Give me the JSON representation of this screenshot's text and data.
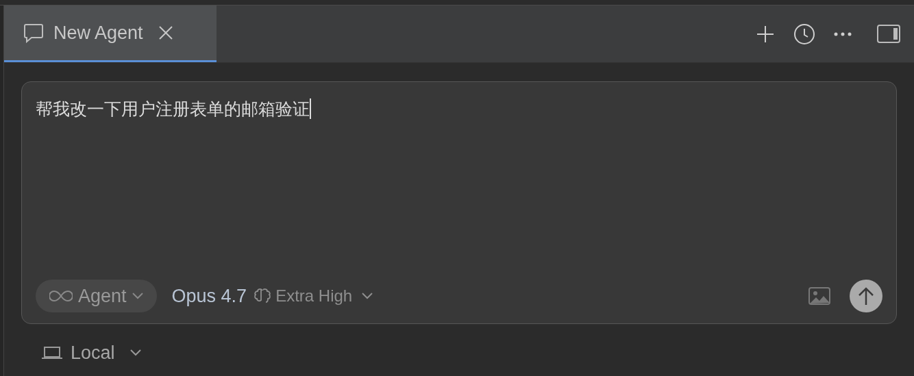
{
  "tabs": [
    {
      "label": "New Agent",
      "selected": true
    }
  ],
  "composer": {
    "value": "帮我改一下用户注册表单的邮箱验证",
    "mode": "Agent",
    "model": "Opus 4.7",
    "effort": "Extra High"
  },
  "environment": {
    "label": "Local"
  }
}
